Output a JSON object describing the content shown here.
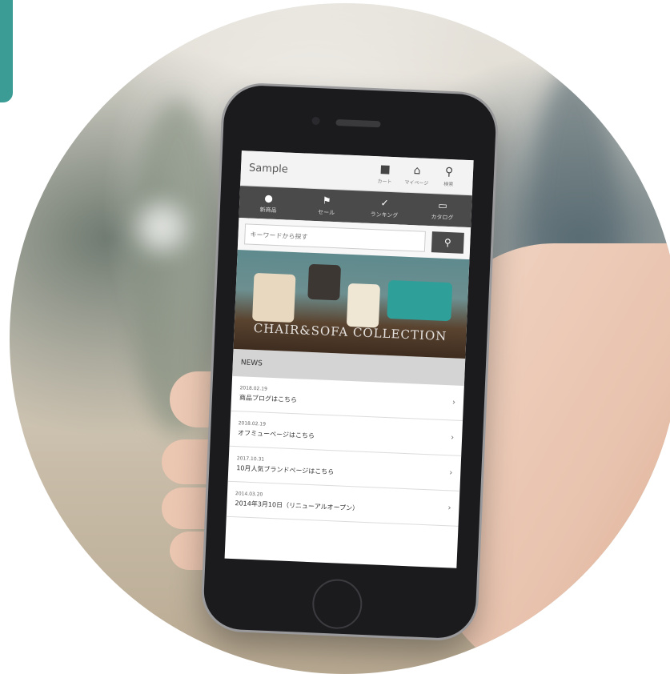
{
  "app": {
    "brand": "Sample"
  },
  "header_icons": [
    {
      "glyph": "■",
      "label": "カート"
    },
    {
      "glyph": "⌂",
      "label": "マイページ"
    },
    {
      "glyph": "⚲",
      "label": "検索"
    }
  ],
  "nav": [
    {
      "glyph": "●",
      "label": "新商品"
    },
    {
      "glyph": "⚑",
      "label": "セール"
    },
    {
      "glyph": "✓",
      "label": "ランキング"
    },
    {
      "glyph": "▭",
      "label": "カタログ"
    }
  ],
  "search": {
    "placeholder": "キーワードから探す",
    "button_glyph": "⚲"
  },
  "hero": {
    "title": "CHAIR&SOFA COLLECTION"
  },
  "news": {
    "heading": "NEWS",
    "items": [
      {
        "date": "2018.02.19",
        "title": "商品ブログはこちら"
      },
      {
        "date": "2018.02.19",
        "title": "オフミューページはこちら"
      },
      {
        "date": "2017.10.31",
        "title": "10月人気ブランドページはこちら"
      },
      {
        "date": "2014.03.20",
        "title": "2014年3月10日（リニューアルオープン）"
      }
    ],
    "chevron": "›"
  },
  "colors": {
    "corner_tab": "#3a9c95",
    "nav_bar": "#4a4a4a",
    "news_header": "#d4d4d4"
  }
}
